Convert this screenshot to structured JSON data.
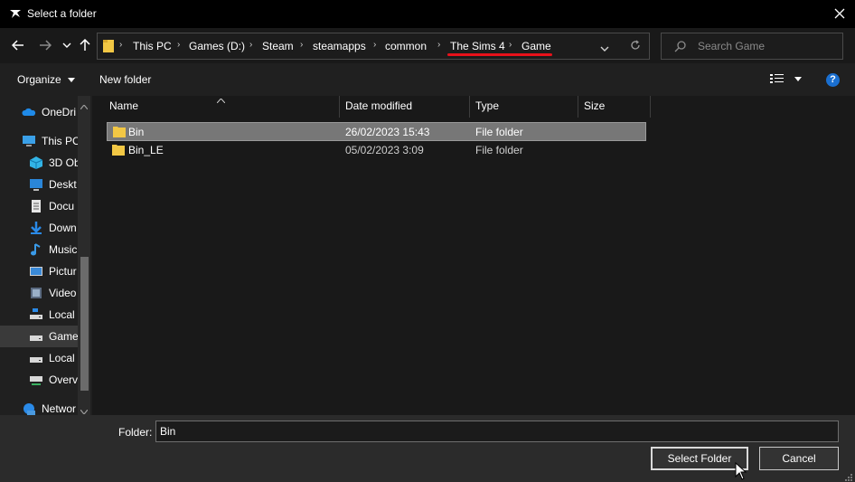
{
  "window": {
    "title": "Select a folder"
  },
  "breadcrumb": [
    {
      "label": "This PC"
    },
    {
      "label": "Games (D:)"
    },
    {
      "label": "Steam"
    },
    {
      "label": "steamapps"
    },
    {
      "label": "common"
    },
    {
      "label": "The Sims 4"
    },
    {
      "label": "Game"
    }
  ],
  "search": {
    "placeholder": "Search Game"
  },
  "toolbar": {
    "organize_label": "Organize",
    "new_folder_label": "New folder",
    "help_label": "?"
  },
  "nav": {
    "items": [
      {
        "label": "OneDri",
        "icon": "onedrive-icon"
      },
      {
        "label": "This PC",
        "icon": "pc-icon"
      },
      {
        "label": "3D Ob",
        "icon": "3d-objects-icon"
      },
      {
        "label": "Deskt",
        "icon": "desktop-icon"
      },
      {
        "label": "Docu",
        "icon": "documents-icon"
      },
      {
        "label": "Down",
        "icon": "downloads-icon"
      },
      {
        "label": "Music",
        "icon": "music-icon"
      },
      {
        "label": "Pictur",
        "icon": "pictures-icon"
      },
      {
        "label": "Video",
        "icon": "videos-icon"
      },
      {
        "label": "Local",
        "icon": "local-disk-icon"
      },
      {
        "label": "Game",
        "icon": "drive-icon"
      },
      {
        "label": "Local",
        "icon": "drive-icon"
      },
      {
        "label": "Overv",
        "icon": "network-drive-icon"
      },
      {
        "label": "Networ",
        "icon": "network-icon"
      }
    ]
  },
  "columns": {
    "name": "Name",
    "date": "Date modified",
    "type": "Type",
    "size": "Size"
  },
  "files": [
    {
      "name": "Bin",
      "date": "26/02/2023 15:43",
      "type": "File folder",
      "size": ""
    },
    {
      "name": "Bin_LE",
      "date": "05/02/2023 3:09",
      "type": "File folder",
      "size": ""
    }
  ],
  "footer": {
    "folder_label": "Folder:",
    "folder_value": "Bin",
    "select_label": "Select Folder",
    "cancel_label": "Cancel"
  },
  "colors": {
    "accent_underline": "#e8111a",
    "folder": "#f2c744",
    "help": "#1a6fd0"
  }
}
